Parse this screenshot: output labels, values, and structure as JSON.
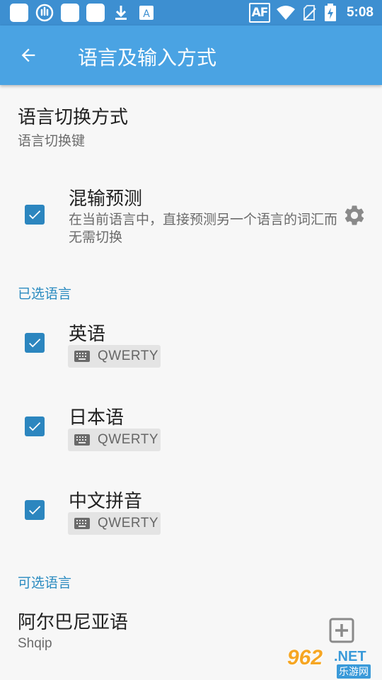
{
  "status_bar": {
    "time": "5:08",
    "af_label": "AF",
    "left_icons": [
      "app-square-icon",
      "hand-tap-icon",
      "app-square-icon",
      "app-square-icon",
      "download-icon",
      "text-a-icon"
    ],
    "right_icons": [
      "wifi-icon",
      "no-sim-icon",
      "battery-charging-icon"
    ]
  },
  "app_bar": {
    "title": "语言及输入方式",
    "back_icon": "arrow-back-icon",
    "color": "#4aa3e3"
  },
  "switch_method": {
    "title": "语言切换方式",
    "summary": "语言切换键"
  },
  "mixed_input": {
    "title": "混输预测",
    "desc": "在当前语言中，直接预测另一个语言的词汇而无需切换",
    "checked": true,
    "settings_icon": "gear-icon"
  },
  "selected_header": "已选语言",
  "selected_languages": [
    {
      "name": "英语",
      "layout": "QWERTY",
      "checked": true
    },
    {
      "name": "日本语",
      "layout": "QWERTY",
      "checked": true
    },
    {
      "name": "中文拼音",
      "layout": "QWERTY",
      "checked": true
    }
  ],
  "available_header": "可选语言",
  "available_languages": [
    {
      "name": "阿尔巴尼亚语",
      "native": "Shqip",
      "action_icon": "add-box-icon"
    }
  ],
  "watermark": {
    "main": "962",
    "domain": ".NET",
    "sub": "乐游网"
  },
  "colors": {
    "status_bar": "#3d8fd1",
    "accent": "#2c86bf",
    "section_header": "#2a8bc0",
    "background": "#f7f7f7"
  }
}
